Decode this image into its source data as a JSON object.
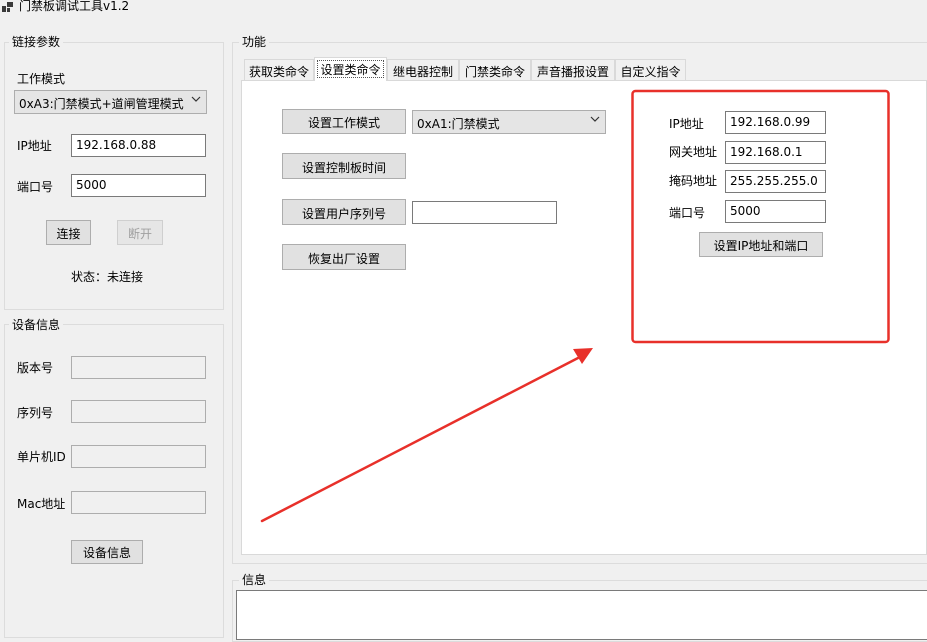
{
  "window": {
    "title": "门禁板调试工具v1.2"
  },
  "connection": {
    "group_title": "链接参数",
    "mode_label": "工作模式",
    "mode_value": "0xA3:门禁模式+道闸管理模式",
    "ip_label": "IP地址",
    "ip_value": "192.168.0.88",
    "port_label": "端口号",
    "port_value": "5000",
    "connect_label": "连接",
    "disconnect_label": "断开",
    "status_text": "状态：未连接"
  },
  "device": {
    "group_title": "设备信息",
    "version_label": "版本号",
    "serial_label": "序列号",
    "mcu_label": "单片机ID",
    "mac_label": "Mac地址",
    "button_label": "设备信息"
  },
  "function": {
    "group_title": "功能",
    "tabs": [
      {
        "label": "获取类命令",
        "active": false
      },
      {
        "label": "设置类命令",
        "active": true
      },
      {
        "label": "继电器控制",
        "active": false
      },
      {
        "label": "门禁类命令",
        "active": false
      },
      {
        "label": "声音播报设置",
        "active": false
      },
      {
        "label": "自定义指令",
        "active": false
      }
    ],
    "set_mode_label": "设置工作模式",
    "mode_combo_value": "0xA1:门禁模式",
    "set_time_label": "设置控制板时间",
    "set_serial_label": "设置用户序列号",
    "user_serial_value": "",
    "factory_reset_label": "恢复出厂设置",
    "network": {
      "ip_label": "IP地址",
      "ip_value": "192.168.0.99",
      "gateway_label": "网关地址",
      "gateway_value": "192.168.0.1",
      "mask_label": "掩码地址",
      "mask_value": "255.255.255.0",
      "port_label": "端口号",
      "port_value": "5000",
      "set_button_label": "设置IP地址和端口"
    }
  },
  "info": {
    "group_title": "信息"
  },
  "colors": {
    "annotation": "#e8302a",
    "window_bg": "#f0f0f0",
    "button_bg": "#e1e1e1"
  },
  "icons": {
    "app": "app-icon",
    "dropdown": "chevron-down-icon",
    "annotation_arrow": "arrow-icon"
  }
}
